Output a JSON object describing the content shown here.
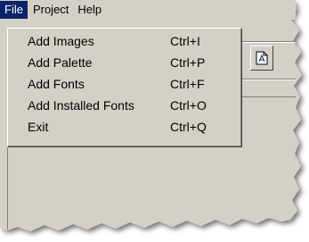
{
  "menubar": {
    "items": [
      {
        "label": "File",
        "active": true
      },
      {
        "label": "Project",
        "active": false
      },
      {
        "label": "Help",
        "active": false
      }
    ]
  },
  "file_menu": {
    "items": [
      {
        "label": "Add Images",
        "shortcut": "Ctrl+I"
      },
      {
        "label": "Add Palette",
        "shortcut": "Ctrl+P"
      },
      {
        "label": "Add Fonts",
        "shortcut": "Ctrl+F"
      },
      {
        "label": "Add Installed Fonts",
        "shortcut": "Ctrl+O"
      },
      {
        "label": "Exit",
        "shortcut": "Ctrl+Q"
      }
    ]
  },
  "toolbar": {
    "button_icon": "document-icon"
  },
  "colors": {
    "menu_highlight": "#0a246a",
    "face": "#d4d0c8"
  }
}
